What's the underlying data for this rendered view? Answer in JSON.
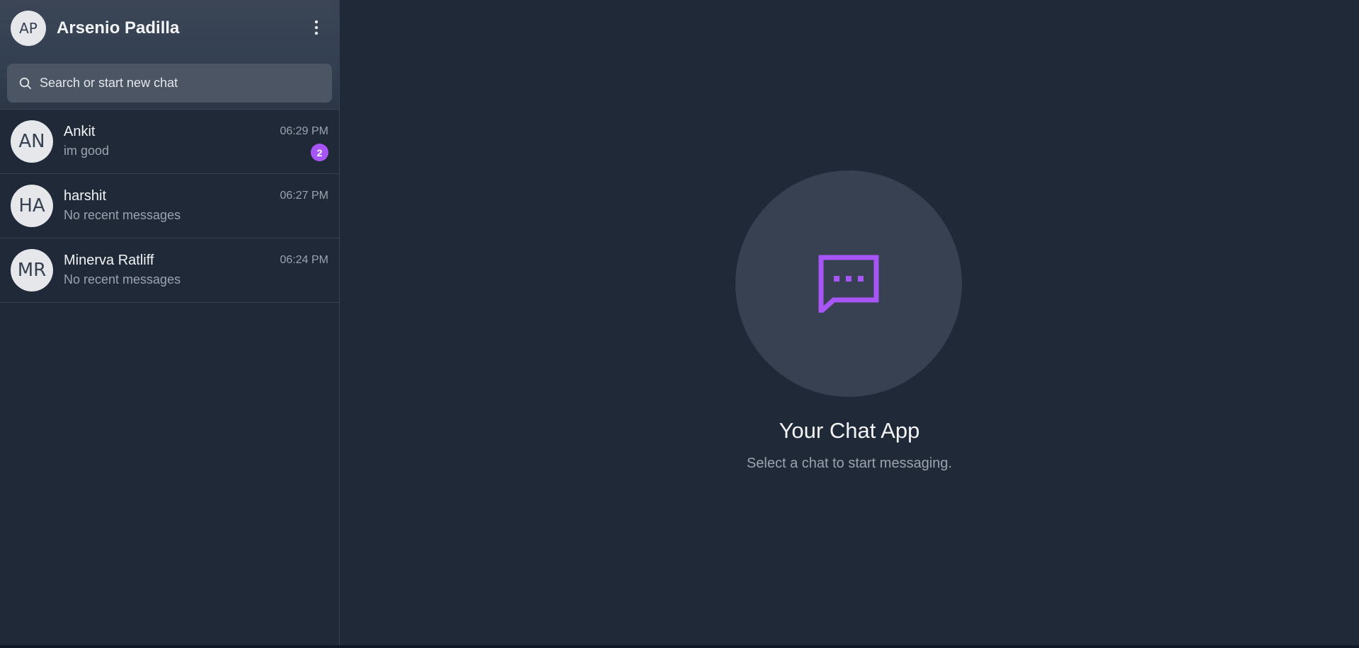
{
  "user": {
    "initials": "AP",
    "name": "Arsenio Padilla"
  },
  "search": {
    "placeholder": "Search or start new chat",
    "value": ""
  },
  "chats": [
    {
      "initials": "AN",
      "name": "Ankit",
      "time": "06:29 PM",
      "preview": "im good",
      "unread": "2"
    },
    {
      "initials": "HA",
      "name": "harshit",
      "time": "06:27 PM",
      "preview": "No recent messages"
    },
    {
      "initials": "MR",
      "name": "Minerva Ratliff",
      "time": "06:24 PM",
      "preview": "No recent messages"
    }
  ],
  "empty_state": {
    "title": "Your Chat App",
    "subtitle": "Select a chat to start messaging.",
    "icon": "chat-bubble-icon"
  },
  "colors": {
    "accent": "#a855f7",
    "background": "#1f2937",
    "panel": "#374151",
    "search_bg": "#4b5563"
  }
}
